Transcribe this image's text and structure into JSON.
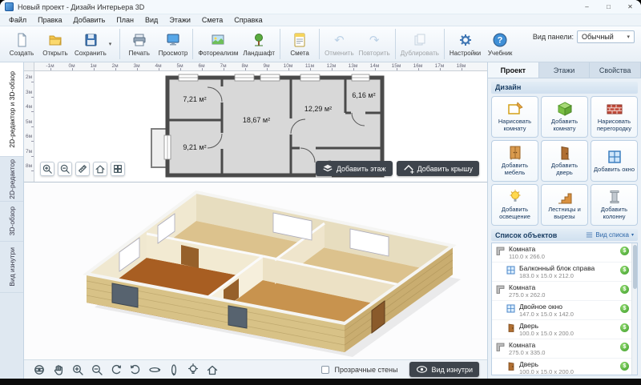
{
  "window": {
    "title": "Новый проект - Дизайн Интерьера 3D"
  },
  "icons": {
    "minimize": "–",
    "maximize": "□",
    "close": "✕",
    "chevron_down": "▾",
    "undo": "↶",
    "redo": "↷",
    "dollar": "$"
  },
  "menu": {
    "items": [
      "Файл",
      "Правка",
      "Добавить",
      "План",
      "Вид",
      "Этажи",
      "Смета",
      "Справка"
    ]
  },
  "toolbar": {
    "buttons": [
      {
        "label": "Создать"
      },
      {
        "label": "Открыть"
      },
      {
        "label": "Сохранить"
      },
      {
        "label": "Печать"
      },
      {
        "label": "Просмотр"
      },
      {
        "label": "Фотореализм"
      },
      {
        "label": "Ландшафт"
      },
      {
        "label": "Смета"
      },
      {
        "label": "Отменить",
        "disabled": true
      },
      {
        "label": "Повторить",
        "disabled": true
      },
      {
        "label": "Дублировать",
        "disabled": true
      },
      {
        "label": "Настройки"
      },
      {
        "label": "Учебник"
      }
    ],
    "view_panel_label": "Вид панели:",
    "view_panel_value": "Обычный"
  },
  "left_tabs": {
    "items": [
      {
        "label": "2D-редактор и 3D-обзор",
        "active": true
      },
      {
        "label": "2D-редактор"
      },
      {
        "label": "3D-обзор"
      },
      {
        "label": "Вид изнутри"
      }
    ]
  },
  "plan2d": {
    "ruler_h": [
      "-1м",
      "0м",
      "1м",
      "2м",
      "3м",
      "4м",
      "5м",
      "6м",
      "7м",
      "8м",
      "9м",
      "10м",
      "11м",
      "12м",
      "13м",
      "14м",
      "15м",
      "16м",
      "17м",
      "18м"
    ],
    "ruler_v": [
      "2м",
      "3м",
      "4м",
      "5м",
      "6м",
      "7м",
      "8м"
    ],
    "rooms": [
      {
        "area": "7,21 м²"
      },
      {
        "area": "9,21 м²"
      },
      {
        "area": "18,67 м²"
      },
      {
        "area": "12,29 м²"
      },
      {
        "area": "6,16 м²"
      }
    ],
    "add_floor": "Добавить этаж",
    "add_roof": "Добавить крышу"
  },
  "view3d_bar": {
    "transparent_walls": "Прозрачные стены",
    "inside_view": "Вид изнутри"
  },
  "right_panel": {
    "tabs": [
      {
        "label": "Проект",
        "active": true
      },
      {
        "label": "Этажи"
      },
      {
        "label": "Свойства"
      }
    ],
    "design_title": "Дизайн",
    "design_buttons": [
      {
        "label": "Нарисовать комнату"
      },
      {
        "label": "Добавить комнату"
      },
      {
        "label": "Нарисовать перегородку"
      },
      {
        "label": "Добавить мебель"
      },
      {
        "label": "Добавить дверь"
      },
      {
        "label": "Добавить окно"
      },
      {
        "label": "Добавить освещение"
      },
      {
        "label": "Лестницы и вырезы"
      },
      {
        "label": "Добавить колонну"
      }
    ],
    "objects_title": "Список объектов",
    "objects_view_label": "Вид списка",
    "objects": [
      {
        "name": "Комната",
        "size": "110.0 x 266.0",
        "icon": "room"
      },
      {
        "name": "Балконный блок справа",
        "size": "183.0 x 15.0 x 212.0",
        "icon": "window",
        "indent": 1
      },
      {
        "name": "Комната",
        "size": "275.0 x 262.0",
        "icon": "room"
      },
      {
        "name": "Двойное окно",
        "size": "147.0 x 15.0 x 142.0",
        "icon": "window",
        "indent": 1
      },
      {
        "name": "Дверь",
        "size": "100.0 x 15.0 x 200.0",
        "icon": "door",
        "indent": 1
      },
      {
        "name": "Комната",
        "size": "275.0 x 335.0",
        "icon": "room"
      },
      {
        "name": "Дверь",
        "size": "100.0 x 15.0 x 200.0",
        "icon": "door",
        "indent": 1
      }
    ]
  }
}
